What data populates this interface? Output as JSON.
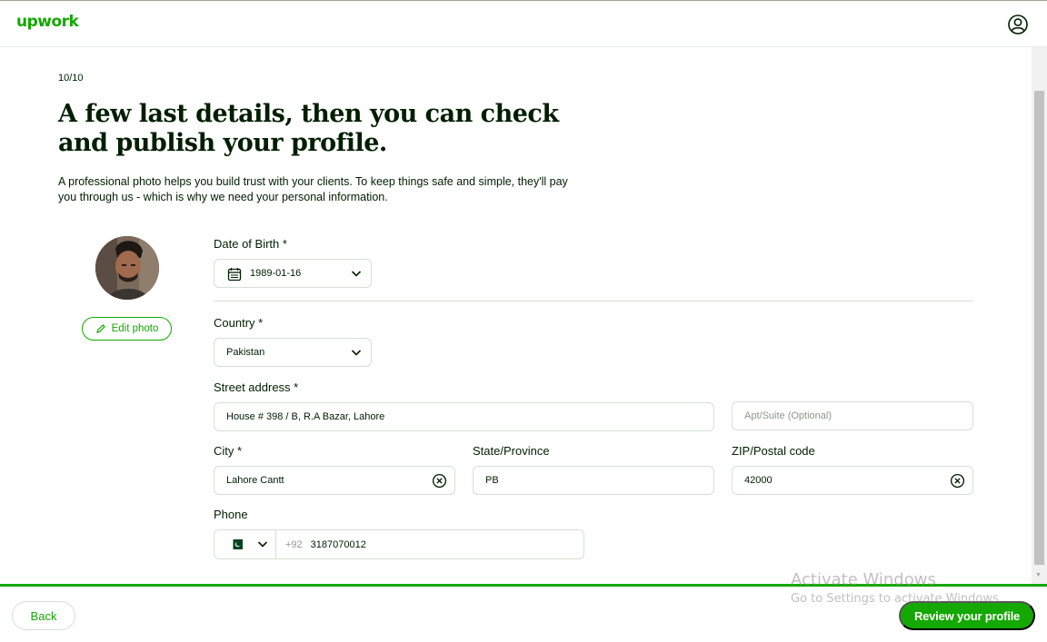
{
  "header": {
    "logo_text": "upwork",
    "account_icon": "user-circle-icon"
  },
  "progress": {
    "step_text": "10/10",
    "fraction": 1.0
  },
  "main": {
    "title": "A few last details, then you can check and publish your profile.",
    "description": "A professional photo helps you build trust with your clients. To keep things safe and simple, they'll pay you through us - which is why we need your personal information.",
    "edit_photo_label": "Edit photo"
  },
  "form": {
    "dob": {
      "label": "Date of Birth *",
      "value": "1989-01-16"
    },
    "country": {
      "label": "Country *",
      "value": "Pakistan"
    },
    "street": {
      "label": "Street address *",
      "value": "House # 398 / B, R.A Bazar, Lahore"
    },
    "apt": {
      "placeholder": "Apt/Suite (Optional)"
    },
    "city": {
      "label": "City *",
      "value": "Lahore Cantt"
    },
    "state": {
      "label": "State/Province",
      "value": "PB"
    },
    "zip": {
      "label": "ZIP/Postal code",
      "value": "42000"
    },
    "phone": {
      "label": "Phone",
      "country_code": "+92",
      "value": "3187070012",
      "flag": "pakistan-flag-icon"
    }
  },
  "footer": {
    "back_label": "Back",
    "review_label": "Review your profile"
  },
  "watermark": {
    "title": "Activate Windows",
    "subtitle": "Go to Settings to activate Windows."
  },
  "colors": {
    "brand_green": "#14a800",
    "text_dark": "#001e00",
    "border": "#d5e0d5"
  }
}
